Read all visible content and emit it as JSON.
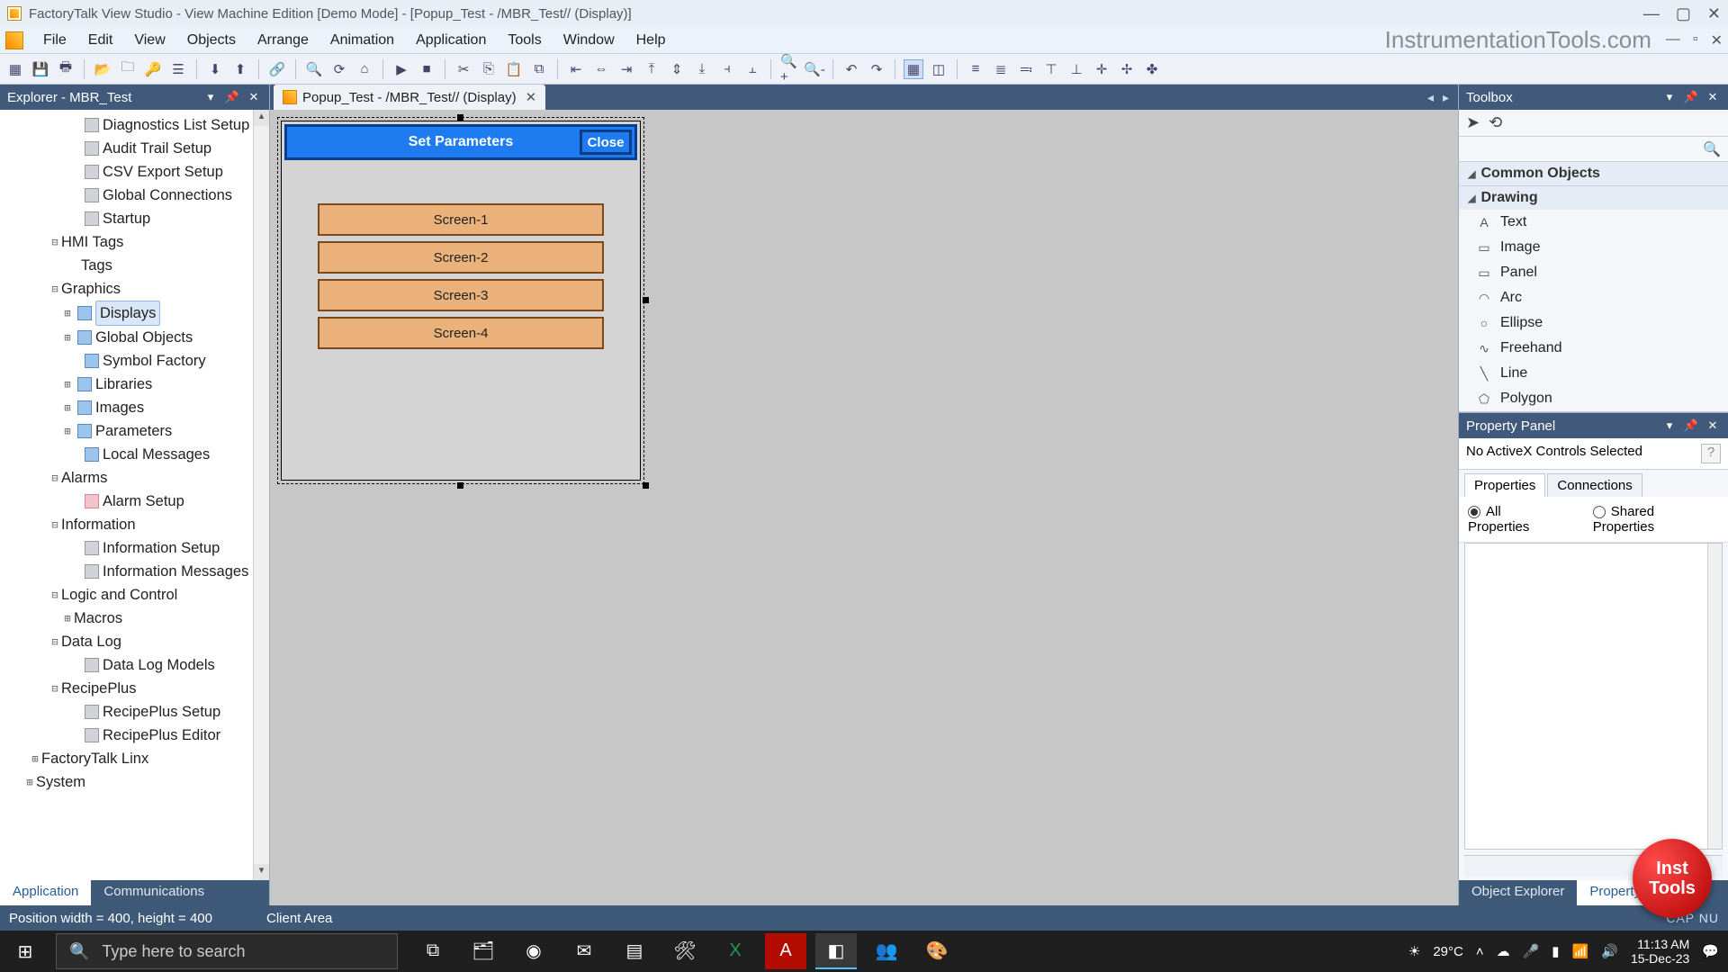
{
  "titlebar": {
    "text": "FactoryTalk View Studio - View Machine Edition  [Demo Mode] - [Popup_Test - /MBR_Test// (Display)]"
  },
  "menubar": {
    "items": [
      "File",
      "Edit",
      "View",
      "Objects",
      "Arrange",
      "Animation",
      "Application",
      "Tools",
      "Window",
      "Help"
    ]
  },
  "watermark": "InstrumentationTools.com",
  "explorer": {
    "title": "Explorer - MBR_Test",
    "tabs": {
      "active": "Application",
      "other": "Communications"
    },
    "nodes": [
      {
        "indent": 70,
        "tw": "",
        "icon": "grey",
        "label": "Diagnostics List Setup"
      },
      {
        "indent": 70,
        "tw": "",
        "icon": "grey",
        "label": "Audit Trail Setup"
      },
      {
        "indent": 70,
        "tw": "",
        "icon": "grey",
        "label": "CSV Export Setup"
      },
      {
        "indent": 70,
        "tw": "",
        "icon": "grey",
        "label": "Global Connections"
      },
      {
        "indent": 70,
        "tw": "",
        "icon": "grey",
        "label": "Startup"
      },
      {
        "indent": 48,
        "tw": "⊟",
        "icon": "",
        "label": "HMI Tags"
      },
      {
        "indent": 70,
        "tw": "",
        "icon": "",
        "label": "Tags"
      },
      {
        "indent": 48,
        "tw": "⊟",
        "icon": "",
        "label": "Graphics"
      },
      {
        "indent": 62,
        "tw": "⊞",
        "icon": "blue",
        "label": "Displays",
        "selected": true
      },
      {
        "indent": 62,
        "tw": "⊞",
        "icon": "blue",
        "label": "Global Objects"
      },
      {
        "indent": 70,
        "tw": "",
        "icon": "blue",
        "label": "Symbol Factory"
      },
      {
        "indent": 62,
        "tw": "⊞",
        "icon": "blue",
        "label": "Libraries"
      },
      {
        "indent": 62,
        "tw": "⊞",
        "icon": "blue",
        "label": "Images"
      },
      {
        "indent": 62,
        "tw": "⊞",
        "icon": "blue",
        "label": "Parameters"
      },
      {
        "indent": 70,
        "tw": "",
        "icon": "blue",
        "label": "Local Messages"
      },
      {
        "indent": 48,
        "tw": "⊟",
        "icon": "",
        "label": "Alarms"
      },
      {
        "indent": 70,
        "tw": "",
        "icon": "pink",
        "label": "Alarm Setup"
      },
      {
        "indent": 48,
        "tw": "⊟",
        "icon": "",
        "label": "Information"
      },
      {
        "indent": 70,
        "tw": "",
        "icon": "grey",
        "label": "Information Setup"
      },
      {
        "indent": 70,
        "tw": "",
        "icon": "grey",
        "label": "Information Messages"
      },
      {
        "indent": 48,
        "tw": "⊟",
        "icon": "",
        "label": "Logic and Control"
      },
      {
        "indent": 62,
        "tw": "⊞",
        "icon": "",
        "label": "Macros"
      },
      {
        "indent": 48,
        "tw": "⊟",
        "icon": "",
        "label": "Data Log"
      },
      {
        "indent": 70,
        "tw": "",
        "icon": "grey",
        "label": "Data Log Models"
      },
      {
        "indent": 48,
        "tw": "⊟",
        "icon": "",
        "label": "RecipePlus"
      },
      {
        "indent": 70,
        "tw": "",
        "icon": "grey",
        "label": "RecipePlus Setup"
      },
      {
        "indent": 70,
        "tw": "",
        "icon": "grey",
        "label": "RecipePlus Editor"
      },
      {
        "indent": 26,
        "tw": "⊞",
        "icon": "",
        "label": "FactoryTalk Linx"
      },
      {
        "indent": 20,
        "tw": "⊞",
        "icon": "",
        "label": "System"
      }
    ]
  },
  "doc_tab": {
    "label": "Popup_Test - /MBR_Test// (Display)"
  },
  "popup": {
    "title": "Set Parameters",
    "close": "Close",
    "screens": [
      "Screen-1",
      "Screen-2",
      "Screen-3",
      "Screen-4"
    ]
  },
  "toolbox": {
    "title": "Toolbox",
    "groups": {
      "common": "Common Objects",
      "drawing": "Drawing"
    },
    "drawing_items": [
      {
        "icon": "A",
        "label": "Text"
      },
      {
        "icon": "▭",
        "label": "Image"
      },
      {
        "icon": "▭",
        "label": "Panel"
      },
      {
        "icon": "◠",
        "label": "Arc"
      },
      {
        "icon": "○",
        "label": "Ellipse"
      },
      {
        "icon": "∿",
        "label": "Freehand"
      },
      {
        "icon": "╲",
        "label": "Line"
      },
      {
        "icon": "⬠",
        "label": "Polygon"
      }
    ]
  },
  "property_panel": {
    "title": "Property Panel",
    "msg": "No ActiveX Controls Selected",
    "tabs": {
      "a": "Properties",
      "b": "Connections"
    },
    "radios": {
      "all": "All Properties",
      "shared": "Shared Properties"
    },
    "bottom_tabs": {
      "a": "Object Explorer",
      "b": "Property Panel"
    }
  },
  "statusbar": {
    "left": "Position width = 400, height = 400",
    "mid": "Client Area",
    "right": "CAP  NU"
  },
  "taskbar": {
    "search_placeholder": "Type here to search",
    "weather": "29°C",
    "time": "11:13 AM",
    "date": "15-Dec-23"
  },
  "badge": "Inst\nTools"
}
